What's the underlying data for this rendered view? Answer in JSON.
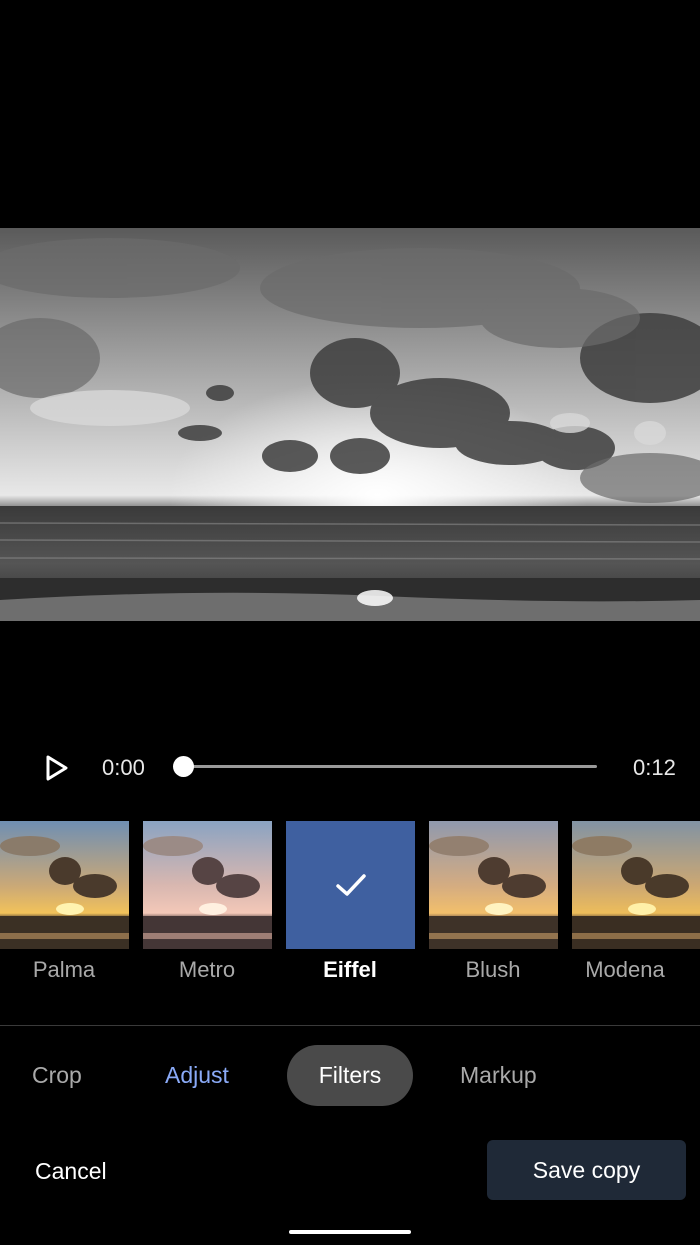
{
  "player": {
    "play_icon": "play-icon",
    "current_time": "0:00",
    "duration": "0:12",
    "progress": 0
  },
  "filters": {
    "selected": "Eiffel",
    "items": [
      {
        "label": "Palma"
      },
      {
        "label": "Metro"
      },
      {
        "label": "Eiffel"
      },
      {
        "label": "Blush"
      },
      {
        "label": "Modena"
      }
    ],
    "selected_color": "#3f60a0",
    "check_icon": "check-icon"
  },
  "tabs": {
    "crop": "Crop",
    "adjust": "Adjust",
    "filters": "Filters",
    "markup": "Markup",
    "accent_color": "#8aaaf7"
  },
  "actions": {
    "cancel": "Cancel",
    "save": "Save copy"
  }
}
